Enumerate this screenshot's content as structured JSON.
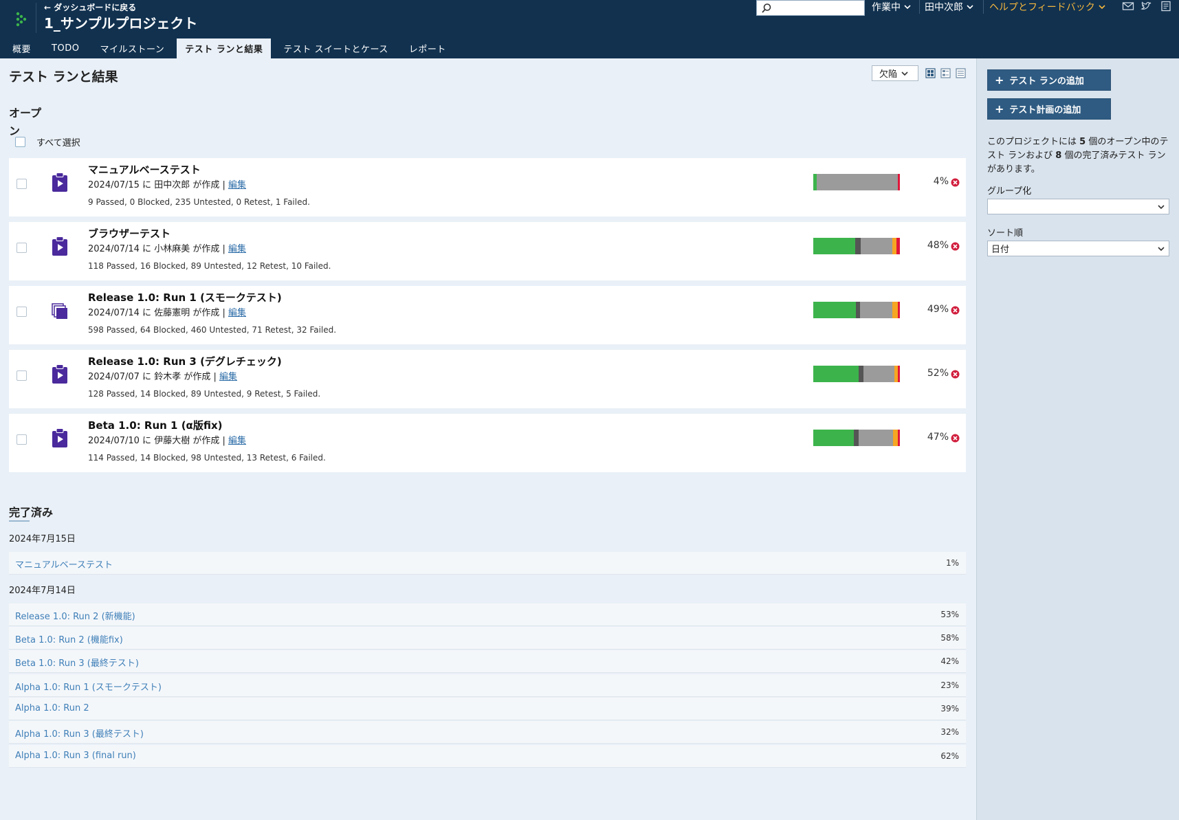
{
  "header": {
    "back_label": "← ダッシュボードに戻る",
    "project_title": "1_サンプルプロジェクト",
    "search_placeholder": "",
    "menus": [
      "作業中",
      "田中次郎",
      "ヘルプとフィードバック"
    ]
  },
  "nav": {
    "tabs": [
      "概要",
      "TODO",
      "マイルストーン",
      "テスト ランと結果",
      "テスト スイートとケース",
      "レポート"
    ],
    "active_index": 3
  },
  "main": {
    "page_title": "テスト ランと結果",
    "filter_label": "欠陥",
    "open_title": "オープン",
    "select_all": "すべて選択",
    "open_runs": [
      {
        "name": "マニュアルベーステスト",
        "meta": "2024/07/15 に 田中次郎 が作成 |",
        "edit": "編集",
        "stats": "9 Passed, 0 Blocked, 235 Untested, 0 Retest, 1 Failed.",
        "percent": "4%",
        "icon": "play-clipboard-icon",
        "progress": {
          "passed": 9,
          "blocked": 0,
          "untested": 235,
          "retest": 0,
          "failed": 1
        }
      },
      {
        "name": "ブラウザーテスト",
        "meta": "2024/07/14 に 小林麻美 が作成 |",
        "edit": "編集",
        "stats": "118 Passed, 16 Blocked, 89 Untested, 12 Retest, 10 Failed.",
        "percent": "48%",
        "icon": "play-clipboard-icon",
        "progress": {
          "passed": 118,
          "blocked": 16,
          "untested": 89,
          "retest": 12,
          "failed": 10
        }
      },
      {
        "name": "Release 1.0: Run 1 (スモークテスト)",
        "meta": "2024/07/14 に 佐藤憲明 が作成 |",
        "edit": "編集",
        "stats": "598 Passed, 64 Blocked, 460 Untested, 71 Retest, 32 Failed.",
        "percent": "49%",
        "icon": "test-plan-icon",
        "progress": {
          "passed": 598,
          "blocked": 64,
          "untested": 460,
          "retest": 71,
          "failed": 32
        }
      },
      {
        "name": "Release 1.0: Run 3 (デグレチェック)",
        "meta": "2024/07/07 に 鈴木孝 が作成 |",
        "edit": "編集",
        "stats": "128 Passed, 14 Blocked, 89 Untested, 9 Retest, 5 Failed.",
        "percent": "52%",
        "icon": "play-clipboard-icon",
        "progress": {
          "passed": 128,
          "blocked": 14,
          "untested": 89,
          "retest": 9,
          "failed": 5
        }
      },
      {
        "name": "Beta 1.0: Run 1 (α版fix)",
        "meta": "2024/07/10 に 伊藤大樹 が作成 |",
        "edit": "編集",
        "stats": "114 Passed, 14 Blocked, 98 Untested, 13 Retest, 6 Failed.",
        "percent": "47%",
        "icon": "play-clipboard-icon",
        "progress": {
          "passed": 114,
          "blocked": 14,
          "untested": 98,
          "retest": 13,
          "failed": 6
        }
      }
    ],
    "completed_title": "完了済み",
    "completed_groups": [
      {
        "date": "2024年7月15日",
        "runs": [
          {
            "name": "マニュアルベーステスト",
            "percent": "1%"
          }
        ]
      },
      {
        "date": "2024年7月14日",
        "runs": [
          {
            "name": "Release 1.0: Run 2 (新機能)",
            "percent": "53%"
          },
          {
            "name": "Beta 1.0: Run 2 (機能fix)",
            "percent": "58%"
          },
          {
            "name": "Beta 1.0: Run 3 (最終テスト)",
            "percent": "42%"
          },
          {
            "name": "Alpha 1.0: Run 1 (スモークテスト)",
            "percent": "23%"
          },
          {
            "name": "Alpha 1.0: Run 2",
            "percent": "39%"
          },
          {
            "name": "Alpha 1.0: Run 3 (最終テスト)",
            "percent": "32%"
          },
          {
            "name": "Alpha 1.0: Run 3 (final run)",
            "percent": "62%"
          }
        ]
      }
    ]
  },
  "sidebar": {
    "add_run": "テスト ランの追加",
    "add_plan": "テスト計画の追加",
    "info_pre": "このプロジェクトには ",
    "open_count": "5",
    "info_mid": " 個のオープン中のテスト ランおよび ",
    "done_count": "8",
    "info_post": " 個の完了済みテスト ランがあります。",
    "group_label": "グループ化",
    "group_value": "",
    "sort_label": "ソート順",
    "sort_value": "日付"
  },
  "colors": {
    "header_bg": "#11314f",
    "passed": "#3cb44b",
    "blocked": "#555555",
    "untested": "#9b9b9b",
    "retest": "#f5a623",
    "failed": "#e1173b",
    "link": "#3f7fb8",
    "button": "#2f5b82"
  }
}
